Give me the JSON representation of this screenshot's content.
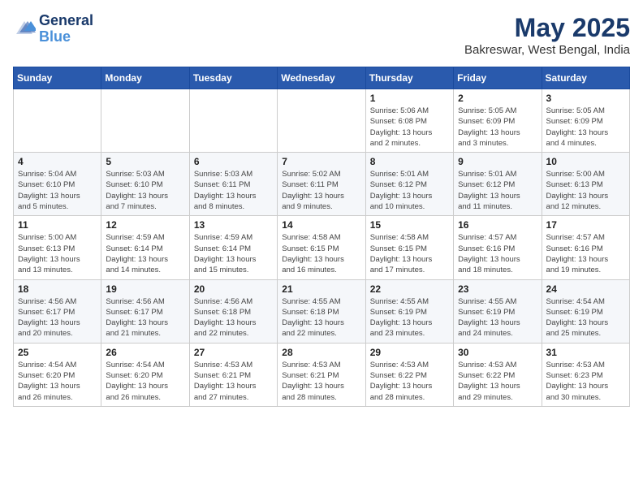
{
  "header": {
    "logo_line1": "General",
    "logo_line2": "Blue",
    "month": "May 2025",
    "location": "Bakreswar, West Bengal, India"
  },
  "weekdays": [
    "Sunday",
    "Monday",
    "Tuesday",
    "Wednesday",
    "Thursday",
    "Friday",
    "Saturday"
  ],
  "weeks": [
    [
      {
        "day": "",
        "info": ""
      },
      {
        "day": "",
        "info": ""
      },
      {
        "day": "",
        "info": ""
      },
      {
        "day": "",
        "info": ""
      },
      {
        "day": "1",
        "info": "Sunrise: 5:06 AM\nSunset: 6:08 PM\nDaylight: 13 hours\nand 2 minutes."
      },
      {
        "day": "2",
        "info": "Sunrise: 5:05 AM\nSunset: 6:09 PM\nDaylight: 13 hours\nand 3 minutes."
      },
      {
        "day": "3",
        "info": "Sunrise: 5:05 AM\nSunset: 6:09 PM\nDaylight: 13 hours\nand 4 minutes."
      }
    ],
    [
      {
        "day": "4",
        "info": "Sunrise: 5:04 AM\nSunset: 6:10 PM\nDaylight: 13 hours\nand 5 minutes."
      },
      {
        "day": "5",
        "info": "Sunrise: 5:03 AM\nSunset: 6:10 PM\nDaylight: 13 hours\nand 7 minutes."
      },
      {
        "day": "6",
        "info": "Sunrise: 5:03 AM\nSunset: 6:11 PM\nDaylight: 13 hours\nand 8 minutes."
      },
      {
        "day": "7",
        "info": "Sunrise: 5:02 AM\nSunset: 6:11 PM\nDaylight: 13 hours\nand 9 minutes."
      },
      {
        "day": "8",
        "info": "Sunrise: 5:01 AM\nSunset: 6:12 PM\nDaylight: 13 hours\nand 10 minutes."
      },
      {
        "day": "9",
        "info": "Sunrise: 5:01 AM\nSunset: 6:12 PM\nDaylight: 13 hours\nand 11 minutes."
      },
      {
        "day": "10",
        "info": "Sunrise: 5:00 AM\nSunset: 6:13 PM\nDaylight: 13 hours\nand 12 minutes."
      }
    ],
    [
      {
        "day": "11",
        "info": "Sunrise: 5:00 AM\nSunset: 6:13 PM\nDaylight: 13 hours\nand 13 minutes."
      },
      {
        "day": "12",
        "info": "Sunrise: 4:59 AM\nSunset: 6:14 PM\nDaylight: 13 hours\nand 14 minutes."
      },
      {
        "day": "13",
        "info": "Sunrise: 4:59 AM\nSunset: 6:14 PM\nDaylight: 13 hours\nand 15 minutes."
      },
      {
        "day": "14",
        "info": "Sunrise: 4:58 AM\nSunset: 6:15 PM\nDaylight: 13 hours\nand 16 minutes."
      },
      {
        "day": "15",
        "info": "Sunrise: 4:58 AM\nSunset: 6:15 PM\nDaylight: 13 hours\nand 17 minutes."
      },
      {
        "day": "16",
        "info": "Sunrise: 4:57 AM\nSunset: 6:16 PM\nDaylight: 13 hours\nand 18 minutes."
      },
      {
        "day": "17",
        "info": "Sunrise: 4:57 AM\nSunset: 6:16 PM\nDaylight: 13 hours\nand 19 minutes."
      }
    ],
    [
      {
        "day": "18",
        "info": "Sunrise: 4:56 AM\nSunset: 6:17 PM\nDaylight: 13 hours\nand 20 minutes."
      },
      {
        "day": "19",
        "info": "Sunrise: 4:56 AM\nSunset: 6:17 PM\nDaylight: 13 hours\nand 21 minutes."
      },
      {
        "day": "20",
        "info": "Sunrise: 4:56 AM\nSunset: 6:18 PM\nDaylight: 13 hours\nand 22 minutes."
      },
      {
        "day": "21",
        "info": "Sunrise: 4:55 AM\nSunset: 6:18 PM\nDaylight: 13 hours\nand 22 minutes."
      },
      {
        "day": "22",
        "info": "Sunrise: 4:55 AM\nSunset: 6:19 PM\nDaylight: 13 hours\nand 23 minutes."
      },
      {
        "day": "23",
        "info": "Sunrise: 4:55 AM\nSunset: 6:19 PM\nDaylight: 13 hours\nand 24 minutes."
      },
      {
        "day": "24",
        "info": "Sunrise: 4:54 AM\nSunset: 6:19 PM\nDaylight: 13 hours\nand 25 minutes."
      }
    ],
    [
      {
        "day": "25",
        "info": "Sunrise: 4:54 AM\nSunset: 6:20 PM\nDaylight: 13 hours\nand 26 minutes."
      },
      {
        "day": "26",
        "info": "Sunrise: 4:54 AM\nSunset: 6:20 PM\nDaylight: 13 hours\nand 26 minutes."
      },
      {
        "day": "27",
        "info": "Sunrise: 4:53 AM\nSunset: 6:21 PM\nDaylight: 13 hours\nand 27 minutes."
      },
      {
        "day": "28",
        "info": "Sunrise: 4:53 AM\nSunset: 6:21 PM\nDaylight: 13 hours\nand 28 minutes."
      },
      {
        "day": "29",
        "info": "Sunrise: 4:53 AM\nSunset: 6:22 PM\nDaylight: 13 hours\nand 28 minutes."
      },
      {
        "day": "30",
        "info": "Sunrise: 4:53 AM\nSunset: 6:22 PM\nDaylight: 13 hours\nand 29 minutes."
      },
      {
        "day": "31",
        "info": "Sunrise: 4:53 AM\nSunset: 6:23 PM\nDaylight: 13 hours\nand 30 minutes."
      }
    ]
  ]
}
